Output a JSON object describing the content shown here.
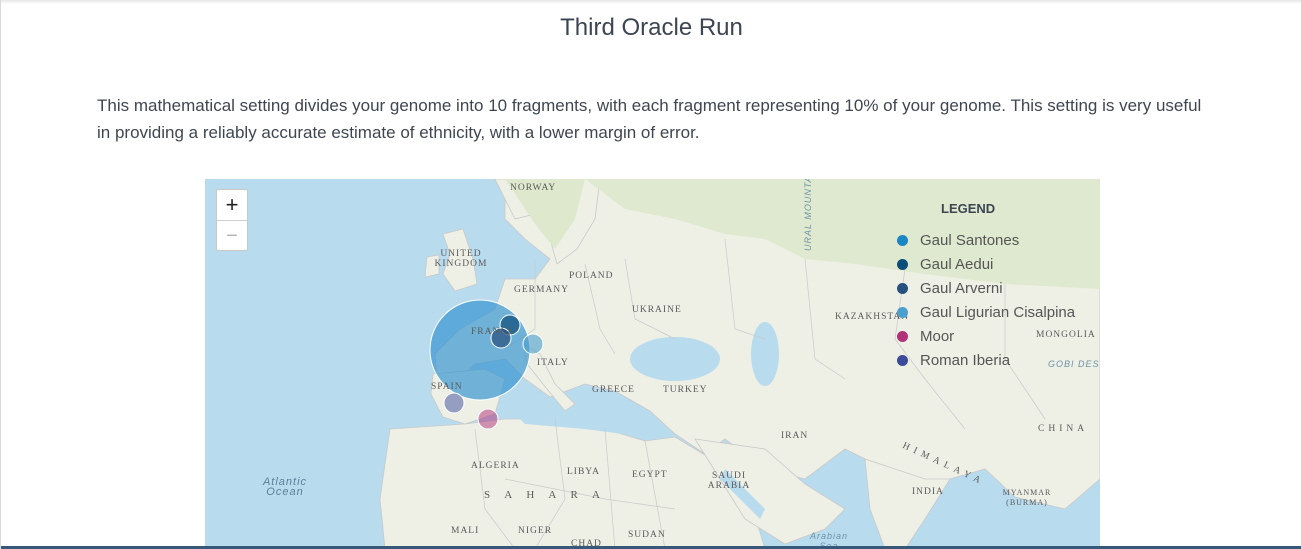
{
  "page": {
    "title": "Third Oracle Run",
    "description": "This mathematical setting divides your genome into 10 fragments, with each fragment representing 10% of your genome. This setting is very useful in providing a reliably accurate estimate of ethnicity, with a lower margin of error."
  },
  "map": {
    "zoom_in": "+",
    "zoom_out": "−",
    "labels": {
      "norway": "NORWAY",
      "uk": "UNITED KINGDOM",
      "poland": "POLAND",
      "germany": "GERMANY",
      "ukraine": "UKRAINE",
      "france": "FRANCE",
      "italy": "ITALY",
      "spain": "SPAIN",
      "greece": "GREECE",
      "turkey": "TURKEY",
      "kazakhstan": "KAZAKHSTAN",
      "mongolia": "MONGOLIA",
      "gobi": "GOBI DESERT",
      "iran": "IRAN",
      "china": "CHINA",
      "himalaya": "HIMALAYA",
      "algeria": "ALGERIA",
      "libya": "LIBYA",
      "egypt": "EGYPT",
      "saudi": "SAUDI ARABIA",
      "india": "INDIA",
      "myanmar": "MYANMAR (BURMA)",
      "sahara": "S A H A R A",
      "mali": "MALI",
      "niger": "NIGER",
      "chad": "CHAD",
      "sudan": "SUDAN",
      "atlantic": "Atlantic Ocean",
      "arabian": "Arabian Sea",
      "ural": "URAL MOUNTAINS"
    }
  },
  "legend": {
    "title": "LEGEND",
    "items": [
      {
        "label": "Gaul Santones",
        "color": "#1a86c4"
      },
      {
        "label": "Gaul Aedui",
        "color": "#0d4d7a"
      },
      {
        "label": "Gaul Arverni",
        "color": "#27507f"
      },
      {
        "label": "Gaul Ligurian Cisalpina",
        "color": "#4a9fcf"
      },
      {
        "label": "Moor",
        "color": "#b0307a"
      },
      {
        "label": "Roman Iberia",
        "color": "#3b4a99"
      }
    ]
  }
}
